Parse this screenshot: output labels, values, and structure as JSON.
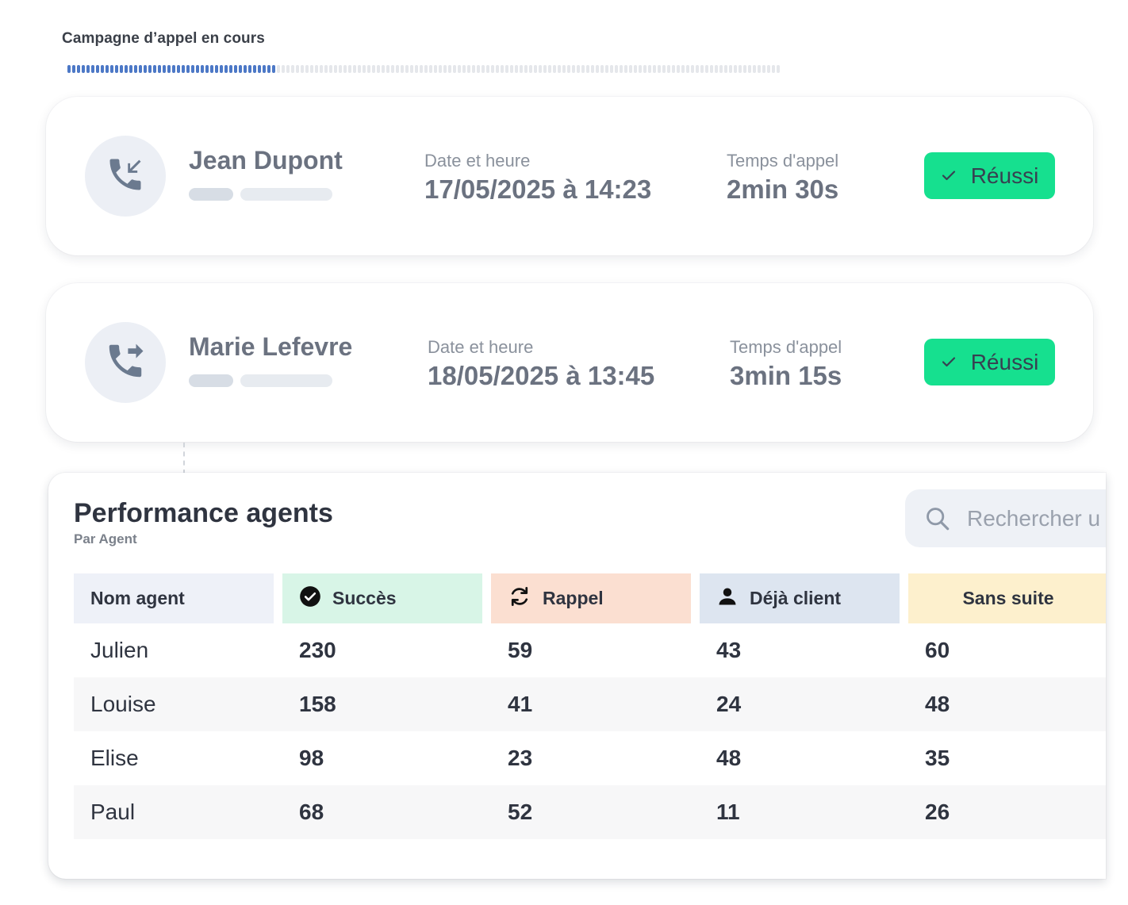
{
  "campaign": {
    "title": "Campagne d’appel en cours",
    "progress": 0.29
  },
  "calls": [
    {
      "direction_icon": "incoming-call-icon",
      "name": "Jean Dupont",
      "date_label": "Date et heure",
      "date_value": "17/05/2025 à 14:23",
      "duration_label": "Temps d'appel",
      "duration_value": "2min 30s",
      "status": "Réussi"
    },
    {
      "direction_icon": "outgoing-call-icon",
      "name": "Marie Lefevre",
      "date_label": "Date et heure",
      "date_value": "18/05/2025 à 13:45",
      "duration_label": "Temps d'appel",
      "duration_value": "3min 15s",
      "status": "Réussi"
    }
  ],
  "performance": {
    "title": "Performance agents",
    "subtitle": "Par Agent",
    "search_placeholder": "Rechercher u",
    "columns": [
      "Nom agent",
      "Succès",
      "Rappel",
      "Déjà client",
      "Sans suite"
    ],
    "column_icons": [
      "",
      "check-circle-icon",
      "refresh-icon",
      "user-icon",
      ""
    ],
    "rows": [
      [
        "Julien",
        "230",
        "59",
        "43",
        "60"
      ],
      [
        "Louise",
        "158",
        "41",
        "24",
        "48"
      ],
      [
        "Elise",
        "98",
        "23",
        "48",
        "35"
      ],
      [
        "Paul",
        "68",
        "52",
        "11",
        "26"
      ]
    ]
  },
  "colors": {
    "success": "#16e08f",
    "progress": "#4c78c6",
    "col_name": "#eef1f8",
    "col_succes": "#d8f5e7",
    "col_rappel": "#fbdfd1",
    "col_client": "#dde5f0",
    "col_sans": "#fdf0cd"
  }
}
